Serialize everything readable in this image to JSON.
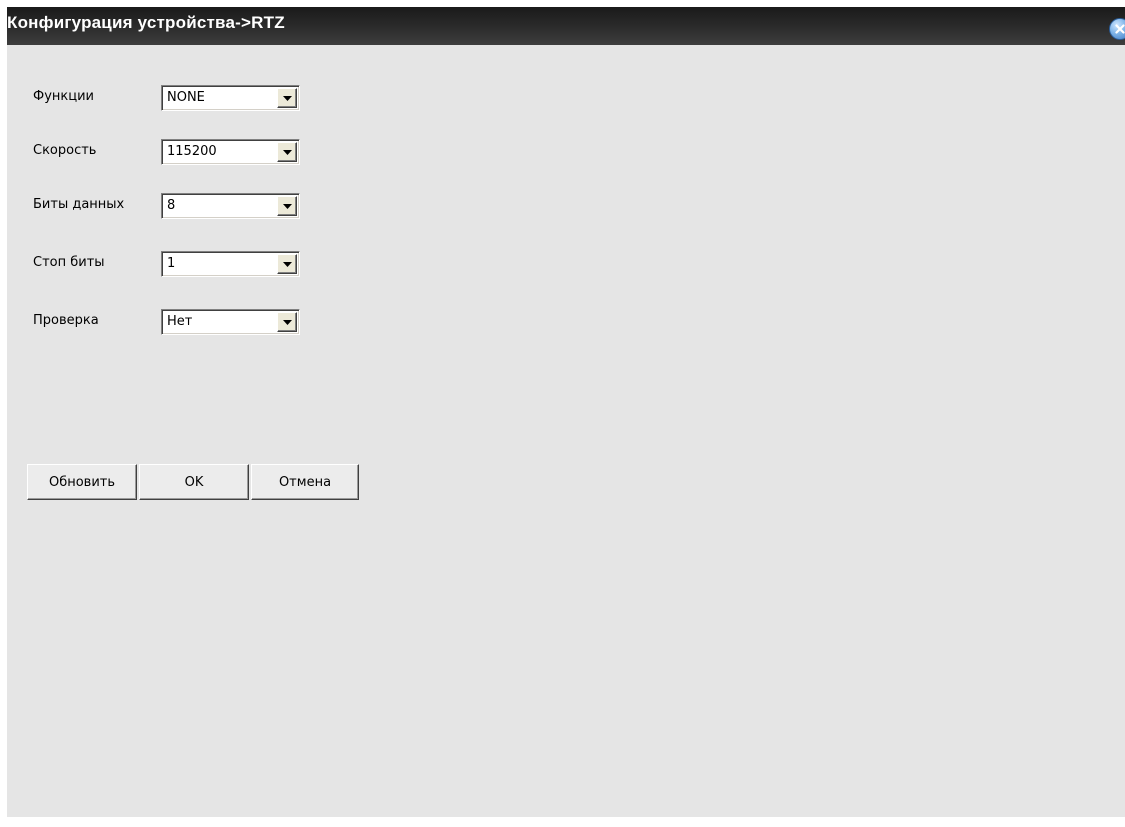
{
  "window": {
    "title": "Конфигурация устройства->RTZ"
  },
  "icons": {
    "close": "close-icon",
    "dropdown": "chevron-down-icon"
  },
  "form": {
    "fields": [
      {
        "label": "Функции",
        "value": "NONE"
      },
      {
        "label": "Скорость",
        "value": "115200"
      },
      {
        "label": "Биты данных",
        "value": "8"
      },
      {
        "label": "Стоп биты",
        "value": "1"
      },
      {
        "label": "Проверка",
        "value": "Нет"
      }
    ]
  },
  "buttons": {
    "refresh": "Обновить",
    "ok": "OK",
    "cancel": "Отмена"
  },
  "colors": {
    "titlebar": "#2c2c2c",
    "panel": "#e5e5e5",
    "close_accent": "#3b79c4"
  }
}
